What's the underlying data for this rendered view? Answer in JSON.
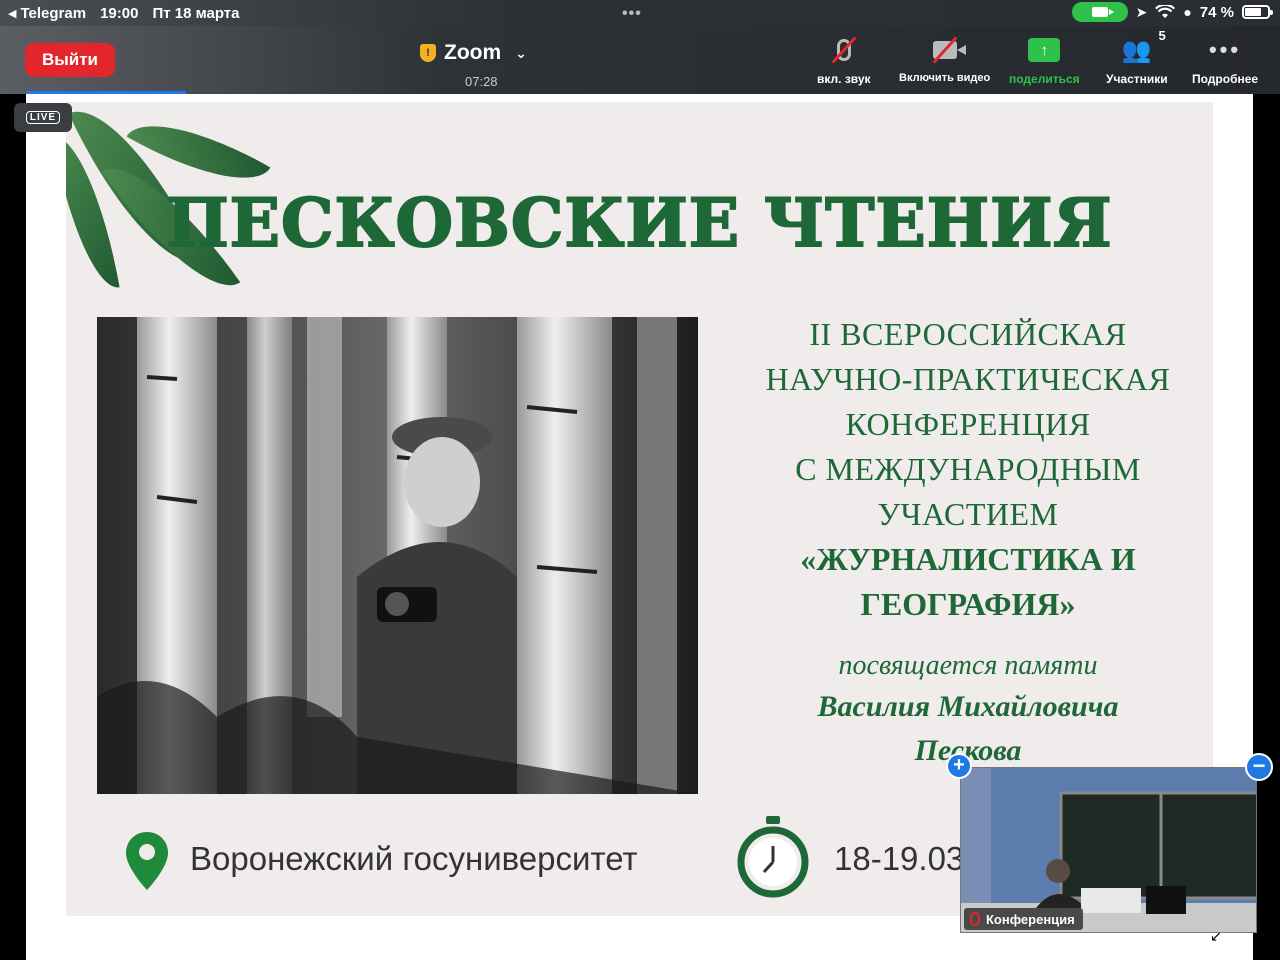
{
  "status_bar": {
    "back_app": "Telegram",
    "time": "19:00",
    "date": "Пт 18 марта",
    "battery": "74 %",
    "battery_level": 0.74
  },
  "toolbar": {
    "leave_label": "Выйти",
    "meeting_title": "Zoom",
    "elapsed": "07:28",
    "buttons": {
      "unmute": "вкл. звук",
      "start_video": "Включить видео",
      "share": "поделиться",
      "participants": "Участники",
      "participants_count": "5",
      "more": "Подробнее"
    }
  },
  "live_badge": "LIVE",
  "slide": {
    "title": "ПЕСКОВСКИЕ ЧТЕНИЯ",
    "conference_lines": [
      "II ВСЕРОССИЙСКАЯ",
      "НАУЧНО-ПРАКТИЧЕСКАЯ",
      "КОНФЕРЕНЦИЯ",
      "С МЕЖДУНАРОДНЫМ",
      "УЧАСТИЕМ"
    ],
    "theme_lines": [
      "«ЖУРНАЛИСТИКА И",
      "ГЕОГРАФИЯ»"
    ],
    "dedication": "посвящается памяти",
    "name_lines": [
      "Василия Михайловича",
      "Пескова"
    ],
    "location": "Воронежский госуниверситет",
    "dates": "18-19.03"
  },
  "self_view": {
    "label": "Конференция"
  },
  "colors": {
    "leave_red": "#e2262b",
    "share_green": "#2ec24a",
    "slide_green": "#1e6838",
    "slide_bg": "#f1ecec",
    "accent_blue": "#1f78e4"
  }
}
